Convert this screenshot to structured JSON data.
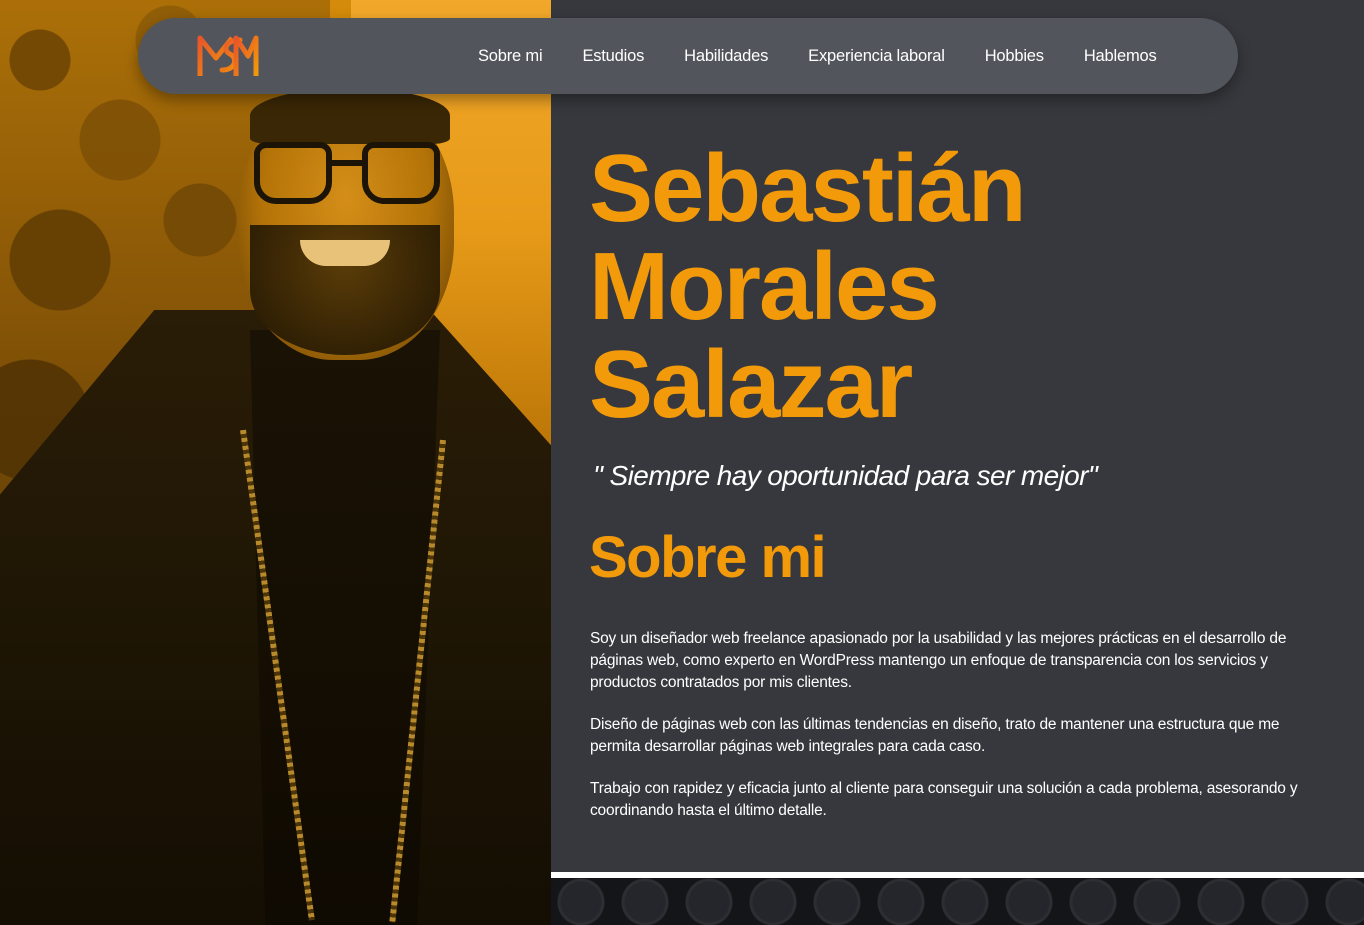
{
  "header": {
    "logo_text": "SM",
    "logo_colors": [
      "#f29a09",
      "#e8552a"
    ],
    "nav": [
      {
        "label": "Sobre mi"
      },
      {
        "label": "Estudios"
      },
      {
        "label": "Habilidades"
      },
      {
        "label": "Experiencia laboral"
      },
      {
        "label": "Hobbies"
      },
      {
        "label": "Hablemos"
      }
    ]
  },
  "hero": {
    "name_lines": [
      "Sebastián",
      "Morales",
      "Salazar"
    ],
    "quote": "\" Siempre hay oportunidad para ser mejor\""
  },
  "about": {
    "title": "Sobre mi",
    "paragraphs": [
      "Soy un diseñador web freelance apasionado por la usabilidad y las mejores prácticas en el desarrollo de páginas web, como experto en WordPress mantengo un enfoque de transparencia con los servicios y productos contratados por mis clientes.",
      "Diseño de páginas web con las últimas tendencias en diseño, trato de mantener una estructura que me permita desarrollar páginas web integrales para cada caso.",
      "Trabajo con rapidez y eficacia junto al cliente para conseguir una solución a cada problema, asesorando y coordinando hasta el último detalle."
    ]
  },
  "colors": {
    "accent": "#f29a09",
    "background": "#36383d",
    "navbar": "#52555c",
    "text": "#ffffff"
  },
  "icons": {
    "logo": "sm-monogram-logo"
  }
}
